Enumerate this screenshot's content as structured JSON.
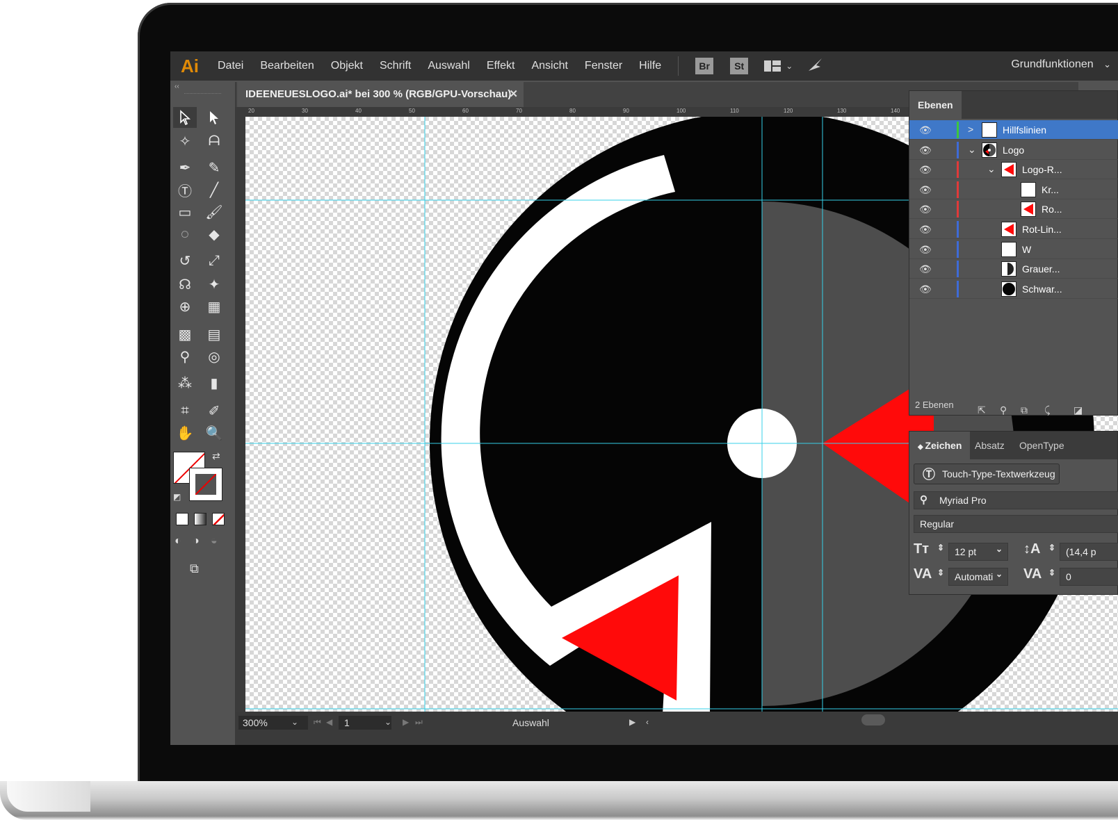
{
  "app": {
    "logo": "Ai"
  },
  "menu": [
    "Datei",
    "Bearbeiten",
    "Objekt",
    "Schrift",
    "Auswahl",
    "Effekt",
    "Ansicht",
    "Fenster",
    "Hilfe"
  ],
  "menu_icons": [
    {
      "label": "Br",
      "name": "bridge-icon"
    },
    {
      "label": "St",
      "name": "stock-icon"
    }
  ],
  "workspace": "Grundfunktionen",
  "document": {
    "tab_title": "IDEENEUESLOGO.ai* bei 300 % (RGB/GPU-Vorschau)",
    "close": "✕"
  },
  "toolbar": {
    "collapse": "‹‹"
  },
  "ruler_h": [
    "20",
    "30",
    "40",
    "50",
    "60",
    "70",
    "80",
    "90",
    "100",
    "110",
    "120",
    "130",
    "140"
  ],
  "statusbar": {
    "zoom": "300%",
    "page": "1",
    "mode": "Auswahl"
  },
  "layers_panel": {
    "tab": "Ebenen",
    "rows": [
      {
        "name": "Hillfslinien",
        "expand": ">",
        "thumb": "white",
        "selected": true,
        "bar": "#3ec53e",
        "indent": 0
      },
      {
        "name": "Logo",
        "expand": "⌄",
        "thumb": "logo",
        "selected": false,
        "bar": "#3f6bd6",
        "indent": 0
      },
      {
        "name": "Logo-R...",
        "expand": "⌄",
        "thumb": "red",
        "selected": false,
        "bar": "#e03a3a",
        "indent": 1
      },
      {
        "name": "Kr...",
        "expand": "",
        "thumb": "white",
        "selected": false,
        "bar": "#e03a3a",
        "indent": 2
      },
      {
        "name": "Ro...",
        "expand": "",
        "thumb": "red",
        "selected": false,
        "bar": "#e03a3a",
        "indent": 2
      },
      {
        "name": "Rot-Lin...",
        "expand": "",
        "thumb": "red",
        "selected": false,
        "bar": "#3f6bd6",
        "indent": 1
      },
      {
        "name": "W",
        "expand": "",
        "thumb": "white",
        "selected": false,
        "bar": "#3f6bd6",
        "indent": 1
      },
      {
        "name": "Grauer...",
        "expand": "",
        "thumb": "half",
        "selected": false,
        "bar": "#3f6bd6",
        "indent": 1
      },
      {
        "name": "Schwar...",
        "expand": "",
        "thumb": "black",
        "selected": false,
        "bar": "#3f6bd6",
        "indent": 1
      }
    ],
    "footer": "2 Ebenen"
  },
  "character_panel": {
    "tabs": [
      "Zeichen",
      "Absatz",
      "OpenType"
    ],
    "touch_type_button": "Touch-Type-Textwerkzeug",
    "font_family": "Myriad Pro",
    "font_style": "Regular",
    "font_size": "12 pt",
    "leading": "(14,4 p",
    "kerning": "Automati",
    "tracking": "0"
  },
  "colors": {
    "accent": "#3f78c8",
    "guide": "#35d0e8",
    "logo_red": "#ff0a0a",
    "logo_gray": "#4d4d4d",
    "logo_black": "#050505"
  }
}
